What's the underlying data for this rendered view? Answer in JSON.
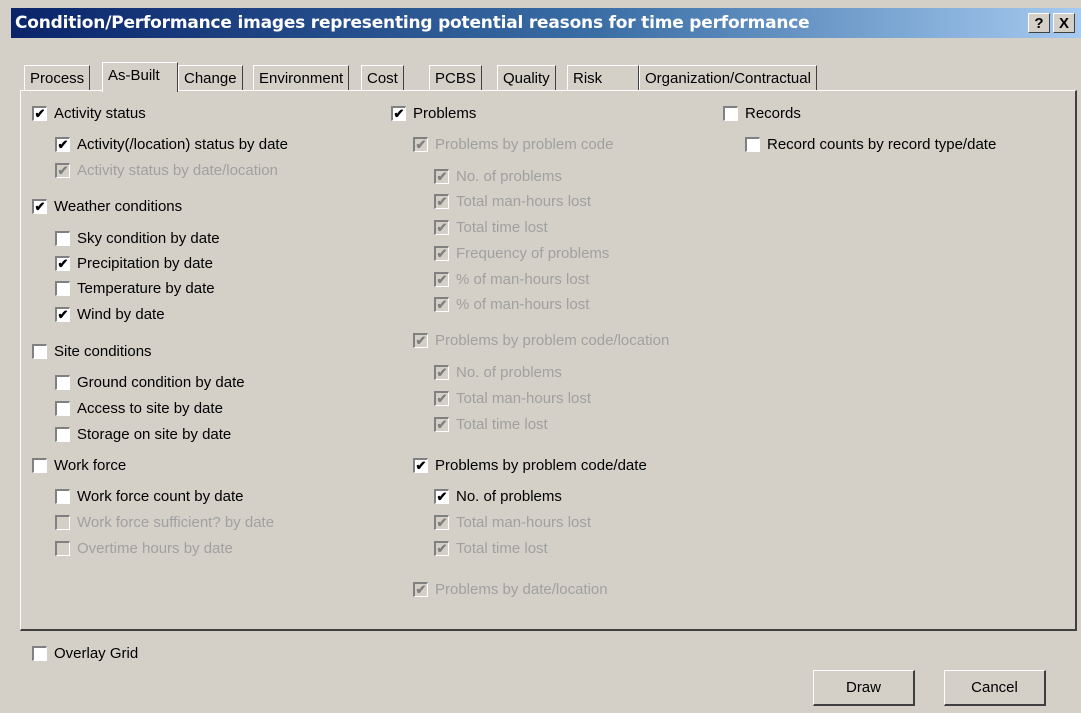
{
  "window": {
    "title": "Condition/Performance images representing potential reasons for time performance",
    "help_label": "?",
    "close_label": "X"
  },
  "tabs": [
    "Process",
    "As-Built",
    "Change",
    "Environment",
    "Cost",
    "PCBS",
    "Quality",
    "Risk",
    "Organization/Contractual"
  ],
  "active_tab": "As-Built",
  "checkboxes": [
    {
      "label": "Activity status",
      "checked": true,
      "disabled": false
    },
    {
      "label": "Activity(/location) status by date",
      "checked": true,
      "disabled": false
    },
    {
      "label": "Activity status by date/location",
      "checked": true,
      "disabled": true
    },
    {
      "label": "Weather conditions",
      "checked": true,
      "disabled": false
    },
    {
      "label": "Sky condition by date",
      "checked": false,
      "disabled": false
    },
    {
      "label": "Precipitation by date",
      "checked": true,
      "disabled": false
    },
    {
      "label": "Temperature by date",
      "checked": false,
      "disabled": false
    },
    {
      "label": "Wind by date",
      "checked": true,
      "disabled": false
    },
    {
      "label": "Site conditions",
      "checked": false,
      "disabled": false
    },
    {
      "label": "Ground condition by date",
      "checked": false,
      "disabled": false
    },
    {
      "label": "Access to site by date",
      "checked": false,
      "disabled": false
    },
    {
      "label": "Storage on site by date",
      "checked": false,
      "disabled": false
    },
    {
      "label": "Work force",
      "checked": false,
      "disabled": false
    },
    {
      "label": "Work force count by date",
      "checked": false,
      "disabled": false
    },
    {
      "label": "Work force sufficient? by date",
      "checked": false,
      "disabled": true
    },
    {
      "label": "Overtime hours by date",
      "checked": false,
      "disabled": true
    },
    {
      "label": "Problems",
      "checked": true,
      "disabled": false
    },
    {
      "label": "Problems by problem code",
      "checked": true,
      "disabled": true
    },
    {
      "label": "No. of problems",
      "checked": true,
      "disabled": true
    },
    {
      "label": "Total man-hours lost",
      "checked": true,
      "disabled": true
    },
    {
      "label": "Total time lost",
      "checked": true,
      "disabled": true
    },
    {
      "label": "Frequency of problems",
      "checked": true,
      "disabled": true
    },
    {
      "label": "% of man-hours lost",
      "checked": true,
      "disabled": true
    },
    {
      "label": "% of man-hours lost",
      "checked": true,
      "disabled": true
    },
    {
      "label": "Problems by problem code/location",
      "checked": true,
      "disabled": true
    },
    {
      "label": "No. of problems",
      "checked": true,
      "disabled": true
    },
    {
      "label": "Total man-hours lost",
      "checked": true,
      "disabled": true
    },
    {
      "label": "Total time lost",
      "checked": true,
      "disabled": true
    },
    {
      "label": "Problems by problem code/date",
      "checked": true,
      "disabled": false
    },
    {
      "label": "No. of problems",
      "checked": true,
      "disabled": false
    },
    {
      "label": "Total man-hours lost",
      "checked": true,
      "disabled": true
    },
    {
      "label": "Total time lost",
      "checked": true,
      "disabled": true
    },
    {
      "label": "Problems by date/location",
      "checked": true,
      "disabled": true
    },
    {
      "label": "Records",
      "checked": false,
      "disabled": false
    },
    {
      "label": "Record counts by record type/date",
      "checked": false,
      "disabled": false
    }
  ],
  "overlay": {
    "label": "Overlay Grid",
    "checked": false
  },
  "buttons": {
    "draw": "Draw",
    "cancel": "Cancel"
  }
}
